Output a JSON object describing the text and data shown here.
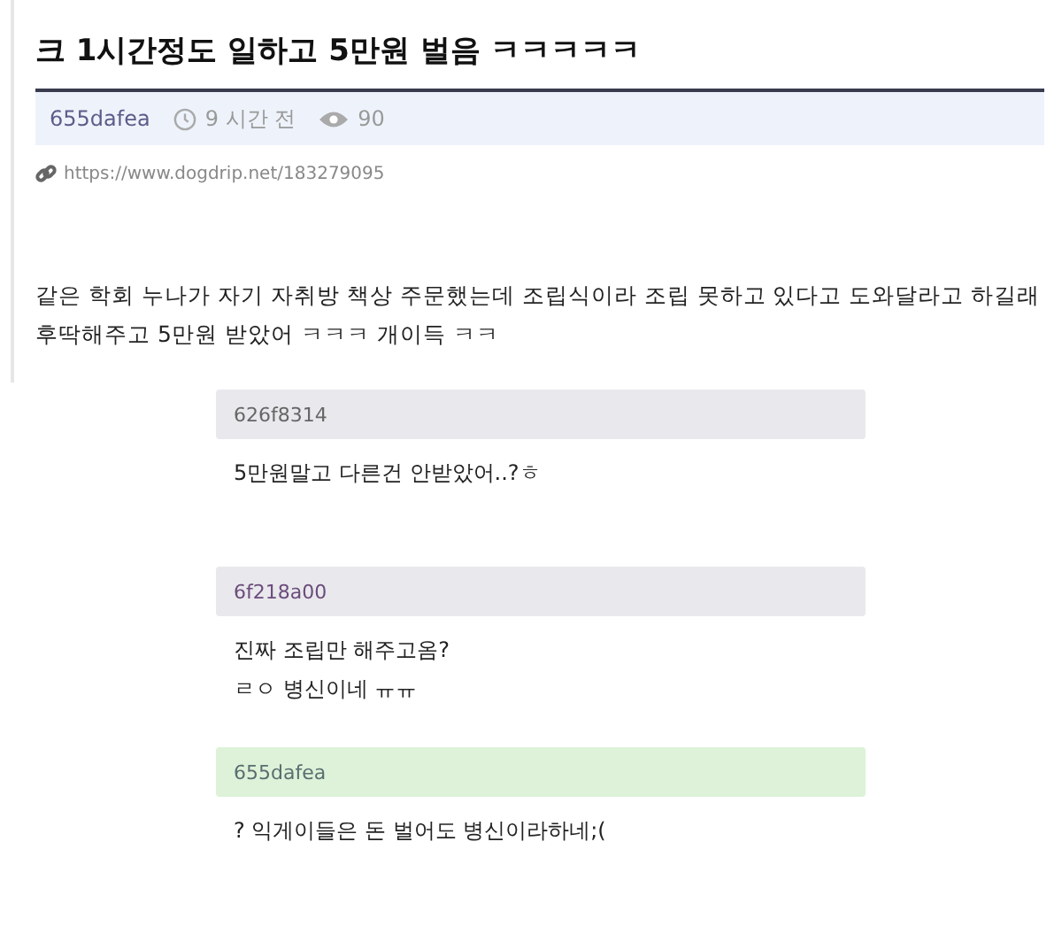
{
  "post": {
    "title": "크 1시간정도 일하고 5만원 벌음 ㅋㅋㅋㅋㅋ",
    "author": "655dafea",
    "time": "9 시간 전",
    "views": "90",
    "url": "https://www.dogdrip.net/183279095",
    "body": [
      "같은 학회 누나가 자기 자취방 책상 주문했는데 조립식이라 조립 못하고 있다고 도와달라고 하길래",
      "후딱해주고 5만원 받았어 ㅋㅋㅋ 개이득 ㅋㅋ"
    ]
  },
  "comments": [
    {
      "author": "626f8314",
      "is_author": false,
      "lines": [
        "5만원말고 다른건 안받았어..?ㅎ"
      ]
    },
    {
      "author": "6f218a00",
      "is_author": false,
      "lines": [
        "진짜 조립만 해주고옴?",
        "ㄹㅇ 병신이네 ㅠㅠ"
      ]
    },
    {
      "author": "655dafea",
      "is_author": true,
      "lines": [
        "? 익게이들은 돈 벌어도 병신이라하네;("
      ]
    }
  ]
}
